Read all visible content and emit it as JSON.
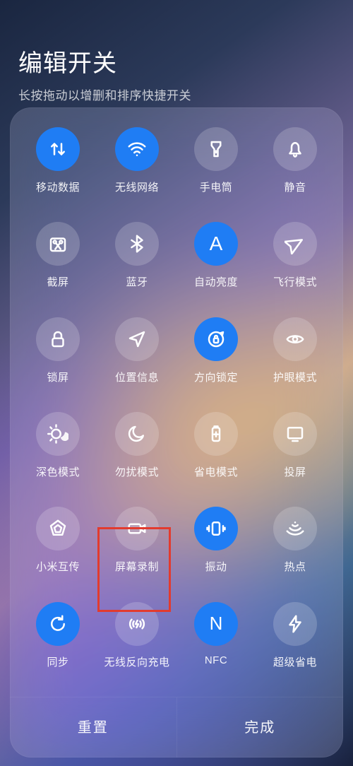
{
  "header": {
    "title": "编辑开关",
    "subtitle": "长按拖动以增删和排序快捷开关"
  },
  "tiles": [
    {
      "id": "mobile-data",
      "label": "移动数据",
      "active": true
    },
    {
      "id": "wifi",
      "label": "无线网络",
      "active": true
    },
    {
      "id": "flashlight",
      "label": "手电筒",
      "active": false
    },
    {
      "id": "mute",
      "label": "静音",
      "active": false
    },
    {
      "id": "screenshot",
      "label": "截屏",
      "active": false
    },
    {
      "id": "bluetooth",
      "label": "蓝牙",
      "active": false
    },
    {
      "id": "auto-brightness",
      "label": "自动亮度",
      "active": true
    },
    {
      "id": "airplane",
      "label": "飞行模式",
      "active": false
    },
    {
      "id": "lock",
      "label": "锁屏",
      "active": false
    },
    {
      "id": "location",
      "label": "位置信息",
      "active": false
    },
    {
      "id": "orientation-lock",
      "label": "方向锁定",
      "active": true
    },
    {
      "id": "eye-protect",
      "label": "护眼模式",
      "active": false
    },
    {
      "id": "dark-mode",
      "label": "深色模式",
      "active": false
    },
    {
      "id": "dnd",
      "label": "勿扰模式",
      "active": false
    },
    {
      "id": "battery-saver",
      "label": "省电模式",
      "active": false
    },
    {
      "id": "cast",
      "label": "投屏",
      "active": false
    },
    {
      "id": "mi-share",
      "label": "小米互传",
      "active": false
    },
    {
      "id": "screen-record",
      "label": "屏幕录制",
      "active": false
    },
    {
      "id": "vibrate",
      "label": "振动",
      "active": true
    },
    {
      "id": "hotspot",
      "label": "热点",
      "active": false
    },
    {
      "id": "sync",
      "label": "同步",
      "active": true
    },
    {
      "id": "reverse-charge",
      "label": "无线反向充电",
      "active": false
    },
    {
      "id": "nfc",
      "label": "NFC",
      "active": true
    },
    {
      "id": "ultra-battery",
      "label": "超级省电",
      "active": false
    }
  ],
  "footer": {
    "reset": "重置",
    "done": "完成"
  },
  "highlighted_tile": "reverse-charge"
}
